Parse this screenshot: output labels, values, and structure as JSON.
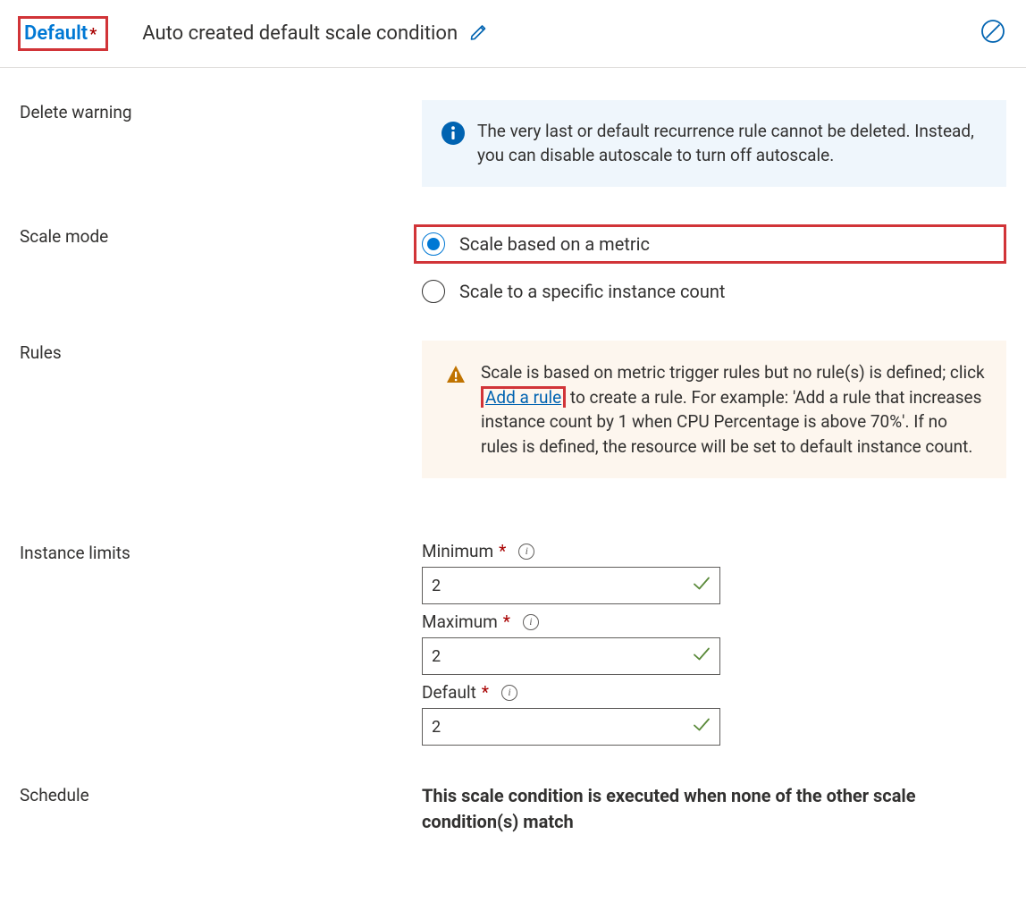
{
  "header": {
    "default_label": "Default",
    "title": "Auto created default scale condition"
  },
  "sections": {
    "delete": {
      "label": "Delete warning",
      "info_text": "The very last or default recurrence rule cannot be deleted. Instead, you can disable autoscale to turn off autoscale."
    },
    "scale_mode": {
      "label": "Scale mode",
      "options": [
        {
          "label": "Scale based on a metric",
          "selected": true
        },
        {
          "label": "Scale to a specific instance count",
          "selected": false
        }
      ]
    },
    "rules": {
      "label": "Rules",
      "warn_pre": "Scale is based on metric trigger rules but no rule(s) is defined; click ",
      "link": "Add a rule",
      "warn_post": " to create a rule. For example: 'Add a rule that increases instance count by 1 when CPU Percentage is above 70%'. If no rules is defined, the resource will be set to default instance count."
    },
    "limits": {
      "label": "Instance limits",
      "minimum": {
        "label": "Minimum",
        "value": "2"
      },
      "maximum": {
        "label": "Maximum",
        "value": "2"
      },
      "default": {
        "label": "Default",
        "value": "2"
      }
    },
    "schedule": {
      "label": "Schedule",
      "note": "This scale condition is executed when none of the other scale condition(s) match"
    }
  },
  "glyphs": {
    "required": "*"
  }
}
